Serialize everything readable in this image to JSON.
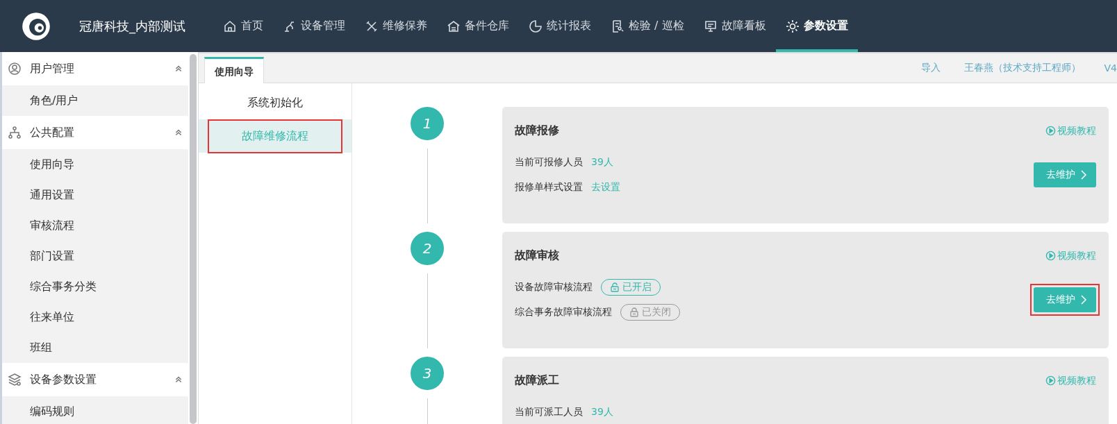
{
  "app": {
    "title": "冠唐科技_内部测试"
  },
  "nav": [
    {
      "label": "首页",
      "selected": false
    },
    {
      "label": "设备管理",
      "selected": false
    },
    {
      "label": "维修保养",
      "selected": false
    },
    {
      "label": "备件仓库",
      "selected": false
    },
    {
      "label": "统计报表",
      "selected": false
    },
    {
      "label": "检验 / 巡检",
      "selected": false
    },
    {
      "label": "故障看板",
      "selected": false
    },
    {
      "label": "参数设置",
      "selected": true
    }
  ],
  "sidebar": [
    {
      "label": "用户管理",
      "expanded": true,
      "children": [
        {
          "label": "角色/用户"
        }
      ]
    },
    {
      "label": "公共配置",
      "expanded": true,
      "children": [
        {
          "label": "使用向导"
        },
        {
          "label": "通用设置"
        },
        {
          "label": "审核流程"
        },
        {
          "label": "部门设置"
        },
        {
          "label": "综合事务分类"
        },
        {
          "label": "往来单位"
        },
        {
          "label": "班组"
        }
      ]
    },
    {
      "label": "设备参数设置",
      "expanded": true,
      "children": [
        {
          "label": "编码规则"
        }
      ]
    }
  ],
  "tabs": [
    {
      "label": "使用向导",
      "selected": true
    }
  ],
  "header_links": [
    "导入",
    "王春燕（技术支持工程师）",
    "V4"
  ],
  "guide_menu": [
    {
      "label": "系统初始化",
      "selected": false,
      "annotated": false
    },
    {
      "label": "故障维修流程",
      "selected": true,
      "annotated": true
    }
  ],
  "steps": [
    {
      "number": "1",
      "title": "故障报修",
      "video_link": "视频教程",
      "button": "去维护",
      "button_annotated": false,
      "rows": [
        {
          "label": "当前可报修人员",
          "kind": "link",
          "value": "39人"
        },
        {
          "label": "报修单样式设置",
          "kind": "link",
          "value": "去设置"
        }
      ]
    },
    {
      "number": "2",
      "title": "故障审核",
      "video_link": "视频教程",
      "button": "去维护",
      "button_annotated": true,
      "rows": [
        {
          "label": "设备故障审核流程",
          "kind": "toggle",
          "on": true,
          "value": "已开启"
        },
        {
          "label": "综合事务故障审核流程",
          "kind": "toggle",
          "on": false,
          "value": "已关闭"
        }
      ]
    },
    {
      "number": "3",
      "title": "故障派工",
      "video_link": "视频教程",
      "rows": [
        {
          "label": "当前可派工人员",
          "kind": "link",
          "value": "39人"
        }
      ]
    }
  ]
}
